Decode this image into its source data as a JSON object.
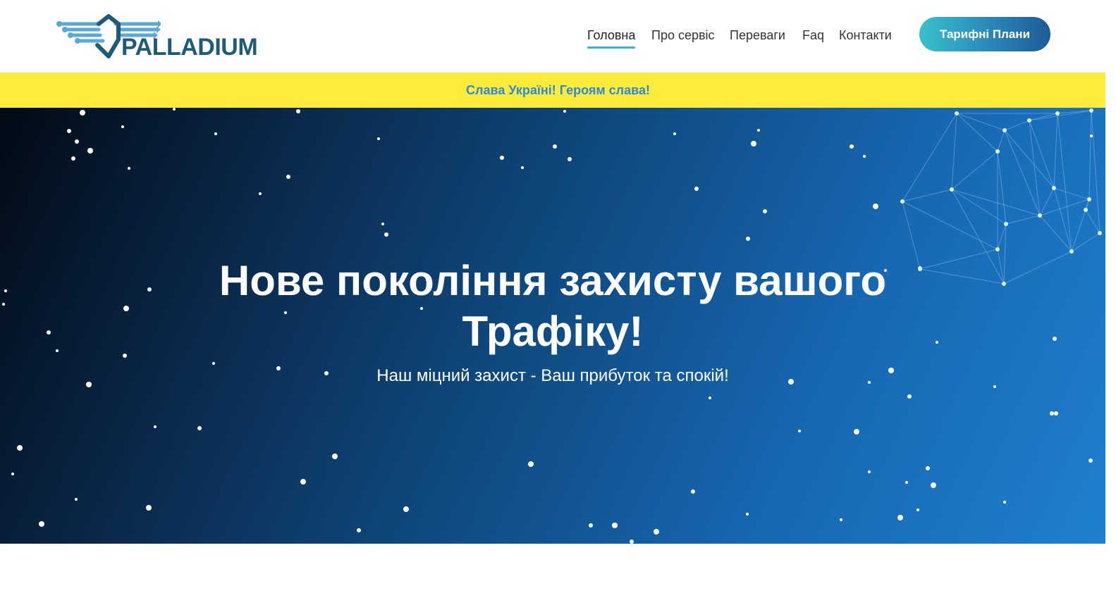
{
  "header": {
    "logo_text": "PALLADIUM",
    "nav": [
      {
        "label": "Головна",
        "active": true
      },
      {
        "label": "Про сервіс",
        "active": false
      },
      {
        "label": "Переваги",
        "active": false
      },
      {
        "label": "Faq",
        "active": false
      },
      {
        "label": "Контакти",
        "active": false
      }
    ],
    "cta_label": "Тарифні Плани"
  },
  "banner": {
    "text": "Слава Україні! Героям слава!"
  },
  "hero": {
    "title_line1": "Нове покоління захисту вашого",
    "title_line2": "Трафіку!",
    "subtitle": "Наш міцний захист - Ваш прибуток та спокій!"
  },
  "colors": {
    "brand_dark": "#1f5b78",
    "brand_light": "#5aa7d9",
    "accent": "#36b6c6",
    "banner_bg": "#ffeb3b",
    "banner_text": "#2b8ad6",
    "hero_dark": "#020a14",
    "hero_light": "#1f80d0"
  },
  "icons": {
    "logo": "palladium-circuit-logo-icon"
  }
}
